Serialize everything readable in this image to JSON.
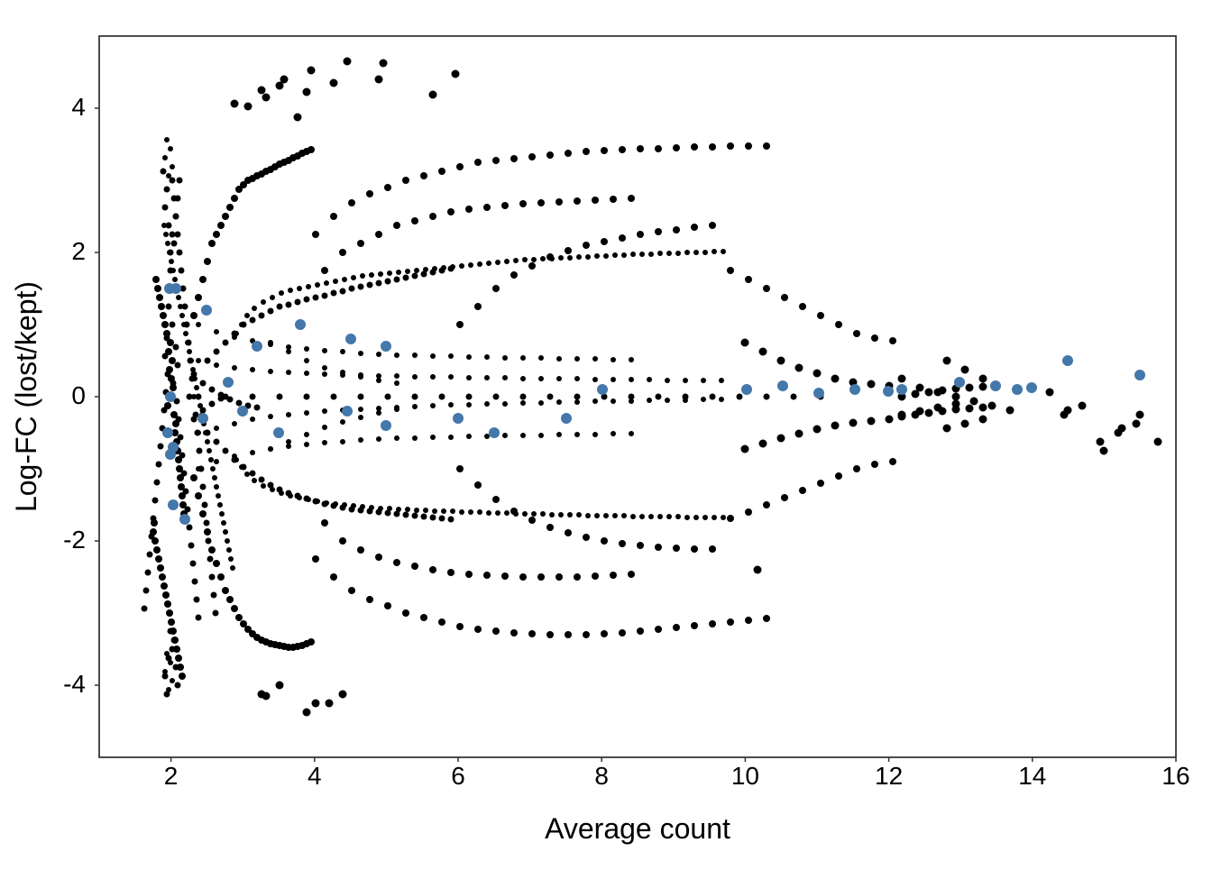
{
  "chart": {
    "title": "",
    "x_axis_label": "Average count",
    "y_axis_label": "Log-FC (lost/kept)",
    "x_min": 1,
    "x_max": 16,
    "y_min": -5,
    "y_max": 5,
    "x_ticks": [
      2,
      4,
      6,
      8,
      10,
      12,
      14,
      16
    ],
    "y_ticks": [
      -4,
      -2,
      0,
      2,
      4
    ],
    "accent_color": "#4477AA",
    "black_color": "#000000"
  }
}
